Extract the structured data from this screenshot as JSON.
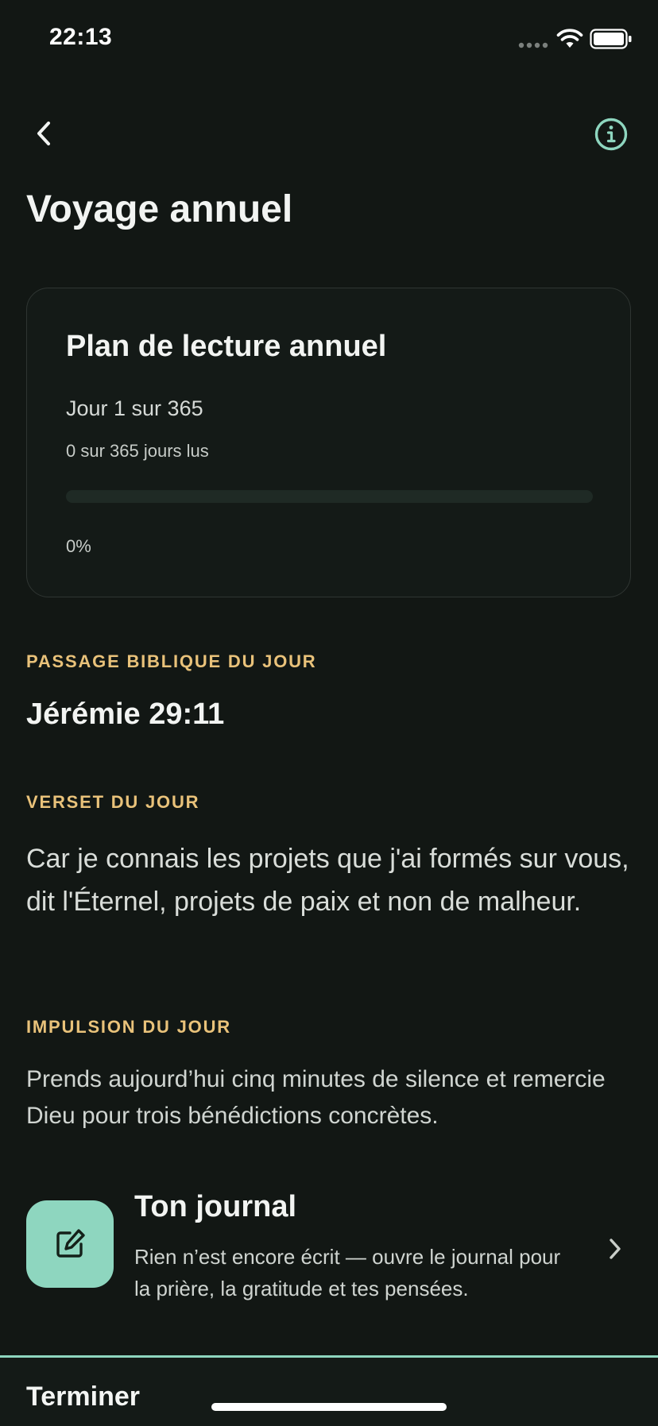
{
  "status_bar": {
    "time": "22:13"
  },
  "header": {
    "back_icon": "chevron-left-icon",
    "info_icon": "info-circle-icon",
    "title": "Voyage annuel"
  },
  "plan_card": {
    "title": "Plan de lecture annuel",
    "day_text": "Jour 1 sur 365",
    "read_text": "0 sur 365 jours lus",
    "progress_fraction": 0,
    "percent_text": "0%"
  },
  "passage": {
    "label": "PASSAGE BIBLIQUE DU JOUR",
    "reference": "Jérémie 29:11"
  },
  "verse": {
    "label": "VERSET DU JOUR",
    "text": "Car je connais les projets que j'ai formés sur vous, dit l'Éternel, projets de paix et non de malheur."
  },
  "impulse": {
    "label": "IMPULSION DU JOUR",
    "text": "Prends aujourd’hui cinq minutes de silence et remercie Dieu pour trois bénédictions concrètes."
  },
  "journal": {
    "icon": "edit-note-icon",
    "title": "Ton journal",
    "description": "Rien n’est encore écrit — ouvre le journal pour la prière, la gratitude et tes pensées.",
    "chevron_icon": "chevron-right-icon"
  },
  "bottom_bar": {
    "finish_label": "Terminer"
  },
  "colors": {
    "background": "#121714",
    "accent_mint": "#8ed6bf",
    "section_label_gold": "#e9c27a",
    "card_border": "#2f3532"
  }
}
